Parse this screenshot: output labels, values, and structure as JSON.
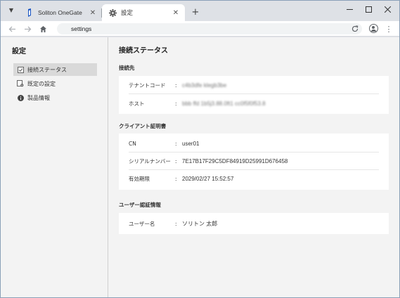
{
  "browser": {
    "tabs": [
      {
        "title": "Soliton OneGate",
        "icon": "onegate-logo-icon",
        "active": false
      },
      {
        "title": "設定",
        "icon": "gear-icon",
        "active": true
      }
    ],
    "url": "settings",
    "accent": "#1a56c4"
  },
  "sidebar": {
    "title": "設定",
    "items": [
      {
        "label": "接続ステータス",
        "icon": "checkbox-icon",
        "active": true
      },
      {
        "label": "既定の設定",
        "icon": "settings-doc-icon",
        "active": false
      },
      {
        "label": "製品情報",
        "icon": "info-icon",
        "active": false
      }
    ]
  },
  "main": {
    "title": "接続ステータス",
    "sections": [
      {
        "label": "接続先",
        "rows": [
          {
            "label": "テナントコード",
            "value": "c4b3dfe klegb3be"
          },
          {
            "label": "ホスト",
            "value": "bbb ffd 1b5j3.88.0ft1 cc0f5f0f53.8"
          }
        ]
      },
      {
        "label": "クライアント証明書",
        "rows": [
          {
            "label": "CN",
            "value": "user01"
          },
          {
            "label": "シリアルナンバー",
            "value": "7E17B17F29C5DF84919D25991D676458"
          },
          {
            "label": "有効期限",
            "value": "2029/02/27 15:52:57"
          }
        ]
      },
      {
        "label": "ユーザー認証情報",
        "rows": [
          {
            "label": "ユーザー名",
            "value": "ソリトン 太郎"
          }
        ]
      }
    ],
    "colon": ":"
  }
}
